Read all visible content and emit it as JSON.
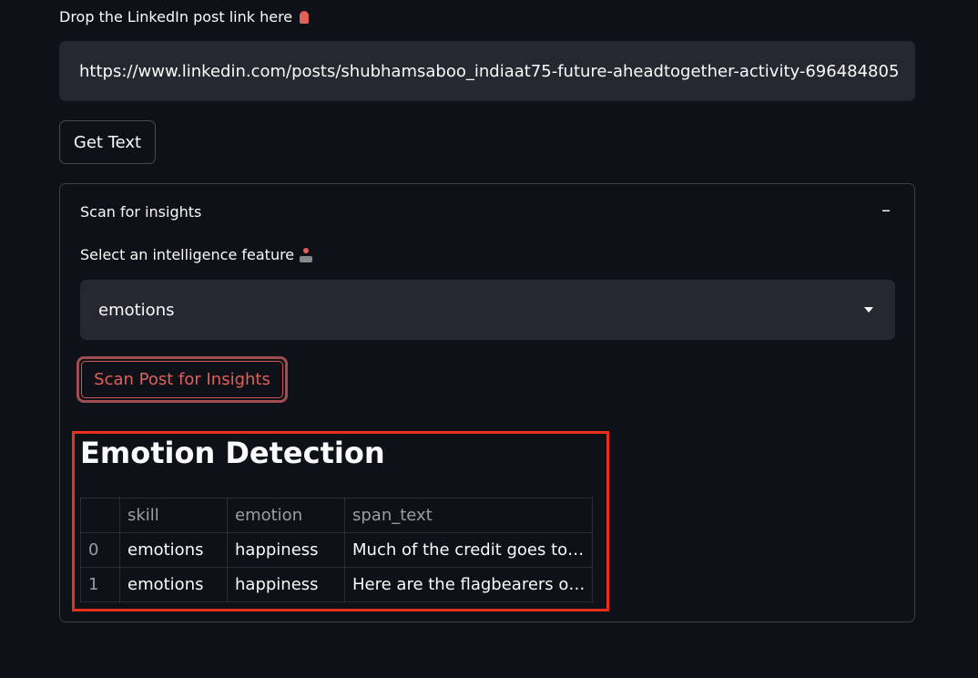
{
  "url_field": {
    "label": "Drop the LinkedIn post link here",
    "label_icon": "pin-icon",
    "value": "https://www.linkedin.com/posts/shubhamsaboo_indiaat75-future-aheadtogether-activity-696484805"
  },
  "get_text_button": {
    "label": "Get Text"
  },
  "expander": {
    "title": "Scan for insights",
    "toggle": "–",
    "select_label": "Select an intelligence feature",
    "select_icon": "joystick-icon",
    "select_value": "emotions",
    "scan_button": "Scan Post for Insights"
  },
  "result": {
    "title": "Emotion Detection",
    "columns": [
      "",
      "skill",
      "emotion",
      "span_text"
    ],
    "rows": [
      [
        "0",
        "emotions",
        "happiness",
        "Much of the credit goes to…"
      ],
      [
        "1",
        "emotions",
        "happiness",
        "Here are the flagbearers o…"
      ]
    ]
  },
  "colors": {
    "background": "#0e1117",
    "input_bg": "#262730",
    "accent_red": "#e0605a",
    "highlight_red": "#e8301c"
  }
}
